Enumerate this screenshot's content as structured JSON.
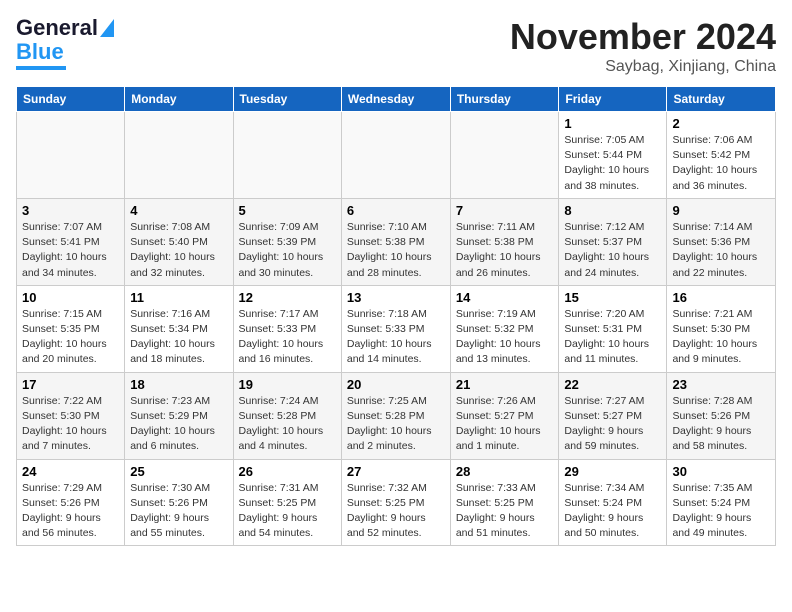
{
  "header": {
    "logo_general": "General",
    "logo_blue": "Blue",
    "month_title": "November 2024",
    "location": "Saybag, Xinjiang, China"
  },
  "days_of_week": [
    "Sunday",
    "Monday",
    "Tuesday",
    "Wednesday",
    "Thursday",
    "Friday",
    "Saturday"
  ],
  "weeks": [
    [
      {
        "day": "",
        "info": ""
      },
      {
        "day": "",
        "info": ""
      },
      {
        "day": "",
        "info": ""
      },
      {
        "day": "",
        "info": ""
      },
      {
        "day": "",
        "info": ""
      },
      {
        "day": "1",
        "info": "Sunrise: 7:05 AM\nSunset: 5:44 PM\nDaylight: 10 hours and 38 minutes."
      },
      {
        "day": "2",
        "info": "Sunrise: 7:06 AM\nSunset: 5:42 PM\nDaylight: 10 hours and 36 minutes."
      }
    ],
    [
      {
        "day": "3",
        "info": "Sunrise: 7:07 AM\nSunset: 5:41 PM\nDaylight: 10 hours and 34 minutes."
      },
      {
        "day": "4",
        "info": "Sunrise: 7:08 AM\nSunset: 5:40 PM\nDaylight: 10 hours and 32 minutes."
      },
      {
        "day": "5",
        "info": "Sunrise: 7:09 AM\nSunset: 5:39 PM\nDaylight: 10 hours and 30 minutes."
      },
      {
        "day": "6",
        "info": "Sunrise: 7:10 AM\nSunset: 5:38 PM\nDaylight: 10 hours and 28 minutes."
      },
      {
        "day": "7",
        "info": "Sunrise: 7:11 AM\nSunset: 5:38 PM\nDaylight: 10 hours and 26 minutes."
      },
      {
        "day": "8",
        "info": "Sunrise: 7:12 AM\nSunset: 5:37 PM\nDaylight: 10 hours and 24 minutes."
      },
      {
        "day": "9",
        "info": "Sunrise: 7:14 AM\nSunset: 5:36 PM\nDaylight: 10 hours and 22 minutes."
      }
    ],
    [
      {
        "day": "10",
        "info": "Sunrise: 7:15 AM\nSunset: 5:35 PM\nDaylight: 10 hours and 20 minutes."
      },
      {
        "day": "11",
        "info": "Sunrise: 7:16 AM\nSunset: 5:34 PM\nDaylight: 10 hours and 18 minutes."
      },
      {
        "day": "12",
        "info": "Sunrise: 7:17 AM\nSunset: 5:33 PM\nDaylight: 10 hours and 16 minutes."
      },
      {
        "day": "13",
        "info": "Sunrise: 7:18 AM\nSunset: 5:33 PM\nDaylight: 10 hours and 14 minutes."
      },
      {
        "day": "14",
        "info": "Sunrise: 7:19 AM\nSunset: 5:32 PM\nDaylight: 10 hours and 13 minutes."
      },
      {
        "day": "15",
        "info": "Sunrise: 7:20 AM\nSunset: 5:31 PM\nDaylight: 10 hours and 11 minutes."
      },
      {
        "day": "16",
        "info": "Sunrise: 7:21 AM\nSunset: 5:30 PM\nDaylight: 10 hours and 9 minutes."
      }
    ],
    [
      {
        "day": "17",
        "info": "Sunrise: 7:22 AM\nSunset: 5:30 PM\nDaylight: 10 hours and 7 minutes."
      },
      {
        "day": "18",
        "info": "Sunrise: 7:23 AM\nSunset: 5:29 PM\nDaylight: 10 hours and 6 minutes."
      },
      {
        "day": "19",
        "info": "Sunrise: 7:24 AM\nSunset: 5:28 PM\nDaylight: 10 hours and 4 minutes."
      },
      {
        "day": "20",
        "info": "Sunrise: 7:25 AM\nSunset: 5:28 PM\nDaylight: 10 hours and 2 minutes."
      },
      {
        "day": "21",
        "info": "Sunrise: 7:26 AM\nSunset: 5:27 PM\nDaylight: 10 hours and 1 minute."
      },
      {
        "day": "22",
        "info": "Sunrise: 7:27 AM\nSunset: 5:27 PM\nDaylight: 9 hours and 59 minutes."
      },
      {
        "day": "23",
        "info": "Sunrise: 7:28 AM\nSunset: 5:26 PM\nDaylight: 9 hours and 58 minutes."
      }
    ],
    [
      {
        "day": "24",
        "info": "Sunrise: 7:29 AM\nSunset: 5:26 PM\nDaylight: 9 hours and 56 minutes."
      },
      {
        "day": "25",
        "info": "Sunrise: 7:30 AM\nSunset: 5:26 PM\nDaylight: 9 hours and 55 minutes."
      },
      {
        "day": "26",
        "info": "Sunrise: 7:31 AM\nSunset: 5:25 PM\nDaylight: 9 hours and 54 minutes."
      },
      {
        "day": "27",
        "info": "Sunrise: 7:32 AM\nSunset: 5:25 PM\nDaylight: 9 hours and 52 minutes."
      },
      {
        "day": "28",
        "info": "Sunrise: 7:33 AM\nSunset: 5:25 PM\nDaylight: 9 hours and 51 minutes."
      },
      {
        "day": "29",
        "info": "Sunrise: 7:34 AM\nSunset: 5:24 PM\nDaylight: 9 hours and 50 minutes."
      },
      {
        "day": "30",
        "info": "Sunrise: 7:35 AM\nSunset: 5:24 PM\nDaylight: 9 hours and 49 minutes."
      }
    ]
  ]
}
